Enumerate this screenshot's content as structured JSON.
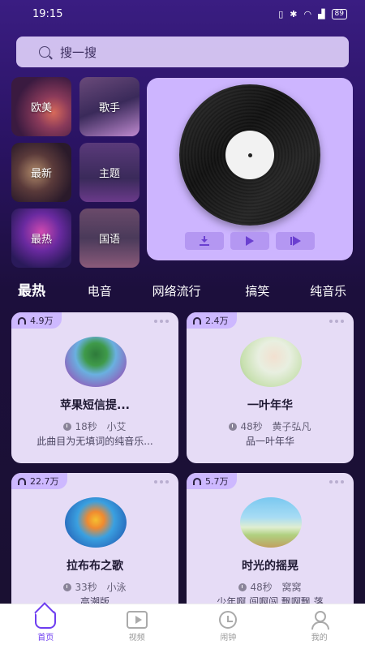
{
  "status": {
    "time": "19:15",
    "battery": "89"
  },
  "search": {
    "placeholder": "搜一搜"
  },
  "categories": [
    {
      "label": "欧美"
    },
    {
      "label": "歌手"
    },
    {
      "label": "最新"
    },
    {
      "label": "主题"
    },
    {
      "label": "最热"
    },
    {
      "label": "国语"
    }
  ],
  "tabs": [
    {
      "label": "最热"
    },
    {
      "label": "电音"
    },
    {
      "label": "网络流行"
    },
    {
      "label": "搞笑"
    },
    {
      "label": "纯音乐"
    }
  ],
  "cards": [
    {
      "plays": "4.9万",
      "title": "苹果短信提...",
      "duration": "18秒",
      "artist": "小艾",
      "desc": "此曲目为无填词的纯音乐..."
    },
    {
      "plays": "2.4万",
      "title": "一叶年华",
      "duration": "48秒",
      "artist": "黄子弘凡",
      "desc": "品一叶年华"
    },
    {
      "plays": "22.7万",
      "title": "拉布布之歌",
      "duration": "33秒",
      "artist": "小泳",
      "desc": "高潮版"
    },
    {
      "plays": "5.7万",
      "title": "时光的摇晃",
      "duration": "48秒",
      "artist": "窝窝",
      "desc": "少年啊 闯啊闯 飘啊飘 落"
    }
  ],
  "nav": [
    {
      "label": "首页"
    },
    {
      "label": "视频"
    },
    {
      "label": "闹钟"
    },
    {
      "label": "我的"
    }
  ]
}
